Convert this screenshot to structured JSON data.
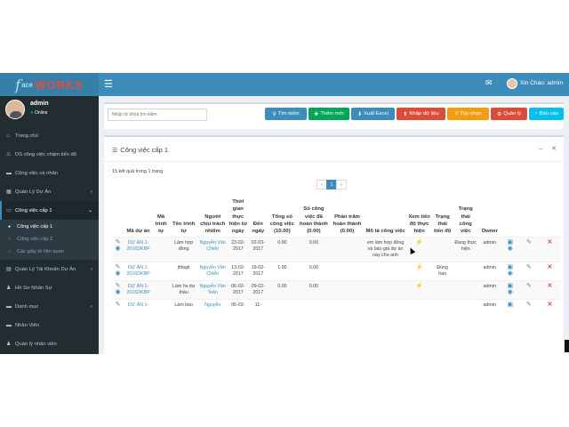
{
  "topbar": {
    "logo_f": "f",
    "logo_ace": "ace",
    "logo_works": "WORKS",
    "menu_toggle_icon": "hamburger-icon",
    "notification_icon": "notification-icon",
    "greeting": "Xin Chào: admin"
  },
  "sidebar": {
    "user_name": "admin",
    "user_status": "Online",
    "items": [
      {
        "label": "Trang chủ",
        "icon": "home-icon"
      },
      {
        "label": "DS công việc chậm tiến độ",
        "icon": "warning-icon"
      },
      {
        "label": "Công việc cá nhân",
        "icon": "folder-icon"
      },
      {
        "label": "Quản Lý Dự Án",
        "icon": "building-icon"
      },
      {
        "label": "Công việc cấp 1",
        "icon": "folder-open-icon"
      },
      {
        "label": "Quản Lý Tài Khoản Dự Án",
        "icon": "id-card-icon"
      },
      {
        "label": "Hồ Sơ Nhân Sự",
        "icon": "user-icon"
      },
      {
        "label": "Danh mục",
        "icon": "folder-icon"
      },
      {
        "label": "Nhân Viên",
        "icon": "folder-icon"
      },
      {
        "label": "Quản lý nhân viên",
        "icon": "users-icon"
      }
    ],
    "sub_items": [
      {
        "label": "Công việc cấp 1"
      },
      {
        "label": "Công việc cấp 2"
      },
      {
        "label": "Các giấy tờ liên quan"
      }
    ]
  },
  "toolbar": {
    "search_placeholder": "Nhập từ khóa tìm kiếm",
    "search_label": "Tìm kiếm",
    "add_label": "Thêm mới",
    "excel_label": "Xuất Excel",
    "import_label": "Nhập dữ liệu",
    "filter_label": "Tùy chọn",
    "manage_label": "Quản lý",
    "report_label": "Báo cáo"
  },
  "panel": {
    "title": "Công việc cấp 1",
    "result_count": "15 kết quả trong 1 trang",
    "pager": {
      "prev": "«",
      "current": "1",
      "next": "»"
    }
  },
  "table": {
    "headers": {
      "project": "Mã dự án",
      "order": "Mã trình tự",
      "name": "Tên trình tự",
      "person": "Người chịu trách nhiệm",
      "time": "Thời gian thực hiện từ ngày",
      "until": "Đến ngày",
      "total": "Tổng số công việc (10.00)",
      "done": "Số công việc đã hoàn thành (0.00)",
      "percent": "Phần trăm hoàn thành (0.00)",
      "desc": "Mô tả công việc",
      "progress": "Xem tiến độ thực hiện",
      "state": "Trạng thái tiến độ",
      "work_state": "Trạng thái công việc",
      "owner": "Owner"
    },
    "rows": [
      {
        "project": "DỰ ÁN 1-2016DKBP",
        "order": "",
        "name": "Làm hợp đồng",
        "person": "Nguyễn Văn Chiến",
        "from": "23-02-2017",
        "to": "02-03-2017",
        "total": "0.00",
        "done": "0.00",
        "percent": "",
        "desc": "em làm hợp đồng và báo giá dự án này cho anh",
        "state": "",
        "work_state": "Đang thực hiện",
        "owner": "admin"
      },
      {
        "project": "DỰ ÁN 1-2016DKBP",
        "order": "",
        "name": "jhfagk",
        "person": "Nguyễn Văn Chiến",
        "from": "13-02-2017",
        "to": "19-02-2017",
        "total": "1.00",
        "done": "0.00",
        "percent": "",
        "desc": "",
        "state": "Đúng hạn",
        "work_state": "",
        "owner": "admin"
      },
      {
        "project": "DỰ ÁN 1-2016DKBP",
        "order": "",
        "name": "Làm hs dự thầu",
        "person": "Nguyễn Văn Toản",
        "from": "06-02-2017",
        "to": "09-02-2017",
        "total": "0.00",
        "done": "0.00",
        "percent": "",
        "desc": "",
        "state": "",
        "work_state": "",
        "owner": "admin"
      },
      {
        "project": "DỰ ÁN 1-",
        "order": "",
        "name": "Làm báo",
        "person": "Nguyễn",
        "from": "06-02-",
        "to": "11-",
        "total": "",
        "done": "",
        "percent": "",
        "desc": "",
        "state": "",
        "work_state": "",
        "owner": "admin"
      }
    ]
  },
  "colors": {
    "topbar": "#3c8dbc",
    "sidebar": "#222d32",
    "btn_blue": "#3c8dbc",
    "btn_green": "#00a65a",
    "btn_red": "#dd4b39",
    "btn_orange": "#f39c12",
    "btn_cyan": "#00c0ef"
  }
}
